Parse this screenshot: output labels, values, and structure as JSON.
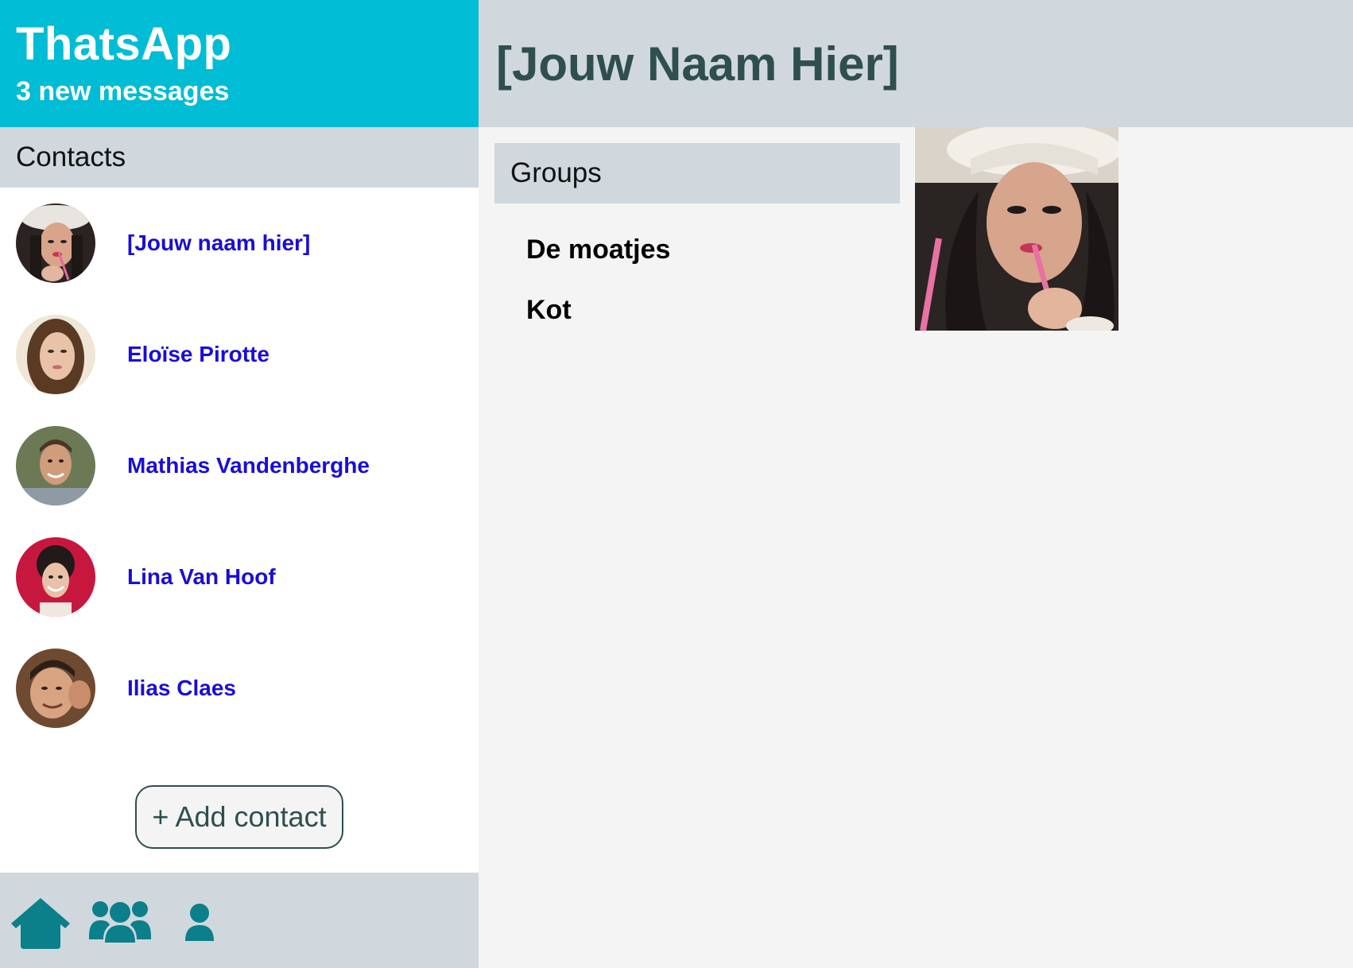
{
  "app": {
    "title": "ThatsApp",
    "subtitle": "3 new messages"
  },
  "sidebar": {
    "contacts_heading": "Contacts",
    "contacts": [
      {
        "name": "[Jouw naam hier]",
        "avatar": "woman-with-straw-avatar"
      },
      {
        "name": "Eloïse Pirotte",
        "avatar": "woman-brown-hair-avatar"
      },
      {
        "name": "Mathias Vandenberghe",
        "avatar": "man-smiling-avatar"
      },
      {
        "name": "Lina Van Hoof",
        "avatar": "woman-curly-hair-avatar"
      },
      {
        "name": "Ilias Claes",
        "avatar": "man-thumbs-up-avatar"
      }
    ],
    "add_contact_label": "+ Add contact"
  },
  "bottom_nav": {
    "items": [
      {
        "icon": "home-icon"
      },
      {
        "icon": "users-group-icon"
      },
      {
        "icon": "user-icon"
      }
    ]
  },
  "main": {
    "page_title": "[Jouw Naam Hier]",
    "groups_heading": "Groups",
    "groups": [
      "De moatjes",
      "Kot"
    ],
    "profile_photo": "woman-with-straw-photo"
  },
  "colors": {
    "brand": "#00bcd4",
    "panel": "#d0d8de",
    "link": "#1a0dd6",
    "title_text": "#2f4f4f",
    "nav_icon": "#0b7f8a",
    "background": "#f4f4f4"
  }
}
